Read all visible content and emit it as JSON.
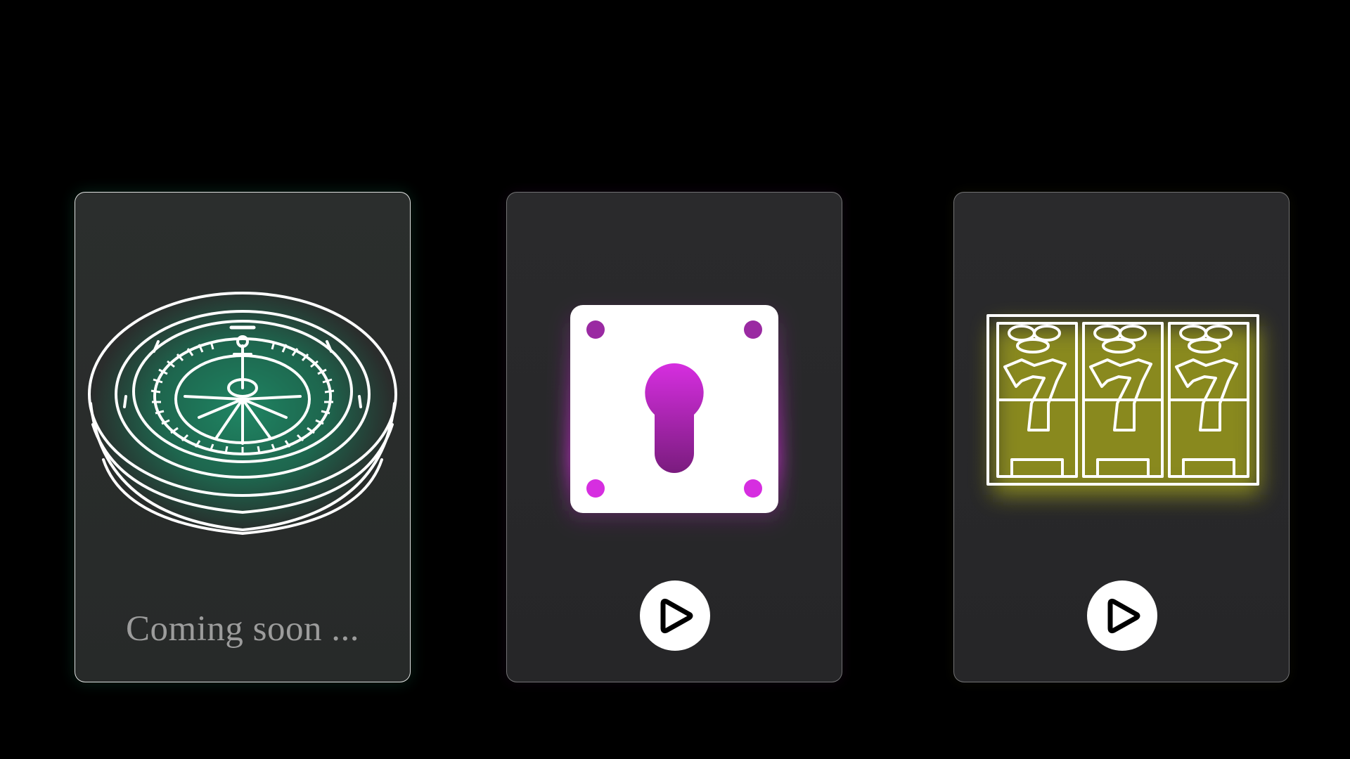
{
  "cards": [
    {
      "id": "roulette",
      "icon": "roulette-wheel-icon",
      "status_text": "Coming soon ...",
      "glow_color": "#1f8a66"
    },
    {
      "id": "lock",
      "icon": "keyhole-lock-icon",
      "action_icon": "play-icon",
      "glow_color": "#d62ee0"
    },
    {
      "id": "slots",
      "icon": "slot-machine-777-icon",
      "action_icon": "play-icon",
      "glow_color": "#c9c92a"
    }
  ],
  "colors": {
    "background": "#000000",
    "card_surface": "#2a2a2c",
    "roulette_accent": "#1f8a66",
    "lock_accent": "#d62ee0",
    "slots_accent": "#a6a620",
    "icon_line": "#ffffff",
    "status_text": "#9c9c9c"
  }
}
